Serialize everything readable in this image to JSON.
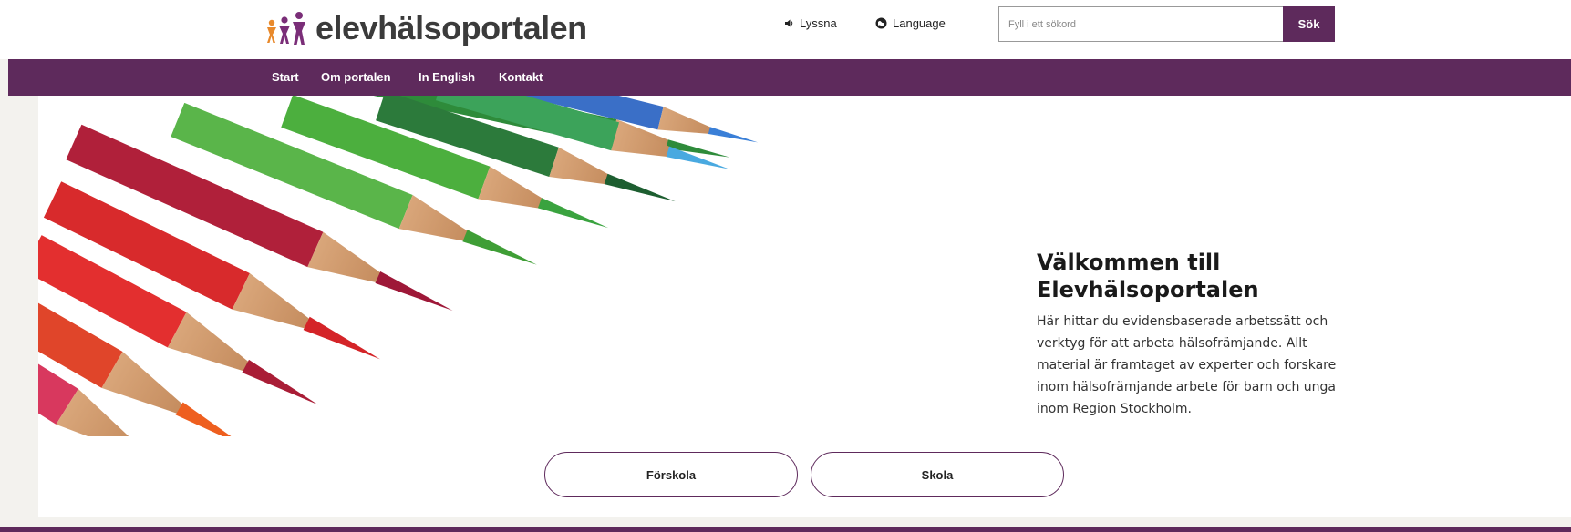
{
  "header": {
    "logo_text": "elevhälsoportalen",
    "listen_label": "Lyssna",
    "language_label": "Language",
    "search": {
      "placeholder": "Fyll i ett sökord",
      "button_label": "Sök"
    }
  },
  "nav": {
    "items": [
      {
        "label": "Start"
      },
      {
        "label": "Om portalen"
      },
      {
        "label": "In English"
      },
      {
        "label": "Kontakt"
      }
    ]
  },
  "welcome": {
    "title": "Välkommen till Elevhälsoportalen",
    "body": "Här hittar du evidensbaserade arbetssätt och verktyg för att arbeta hälsofrämjande. Allt material är framtaget av experter och forskare inom hälsofrämjande arbete för barn och unga inom Region Stockholm."
  },
  "buttons": {
    "preschool": "Förskola",
    "school": "Skola"
  },
  "colors": {
    "brand": "#5e2a5c",
    "background": "#f3f2ee"
  }
}
